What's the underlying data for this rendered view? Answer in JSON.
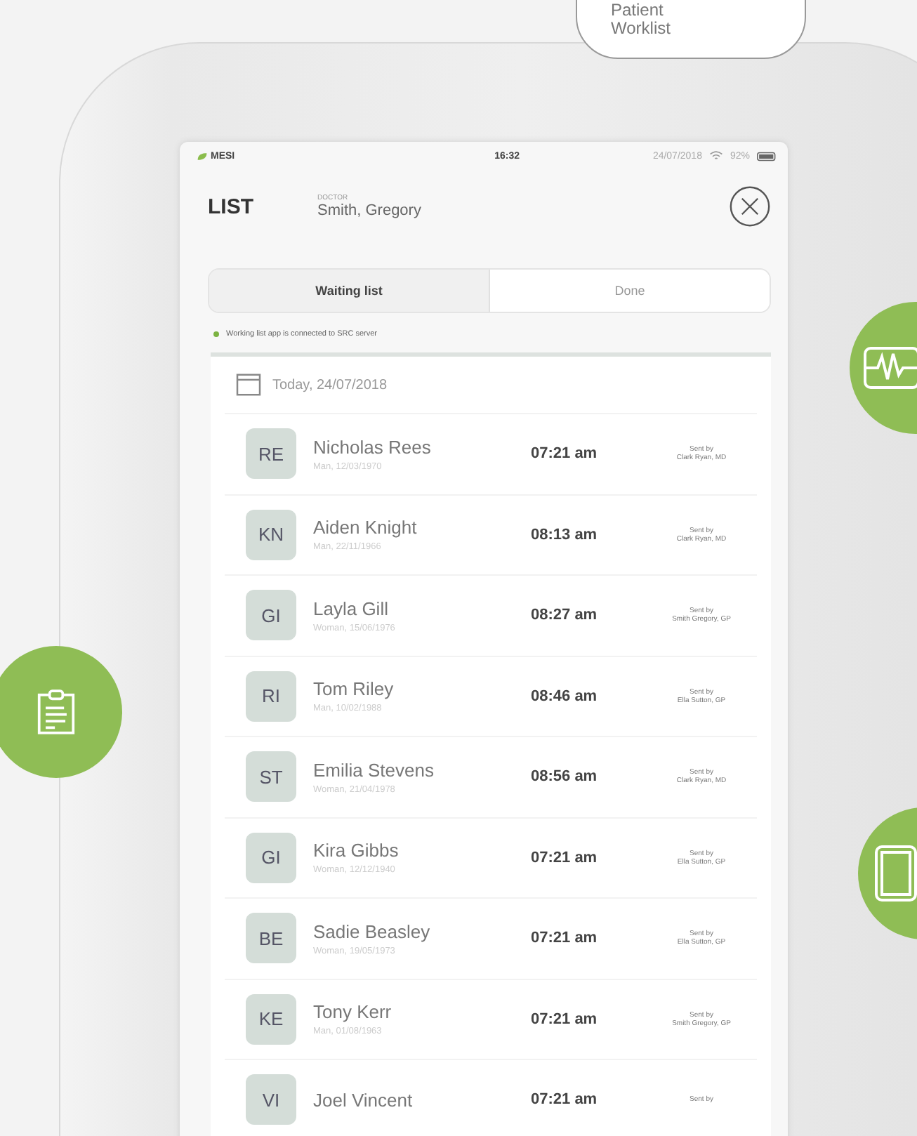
{
  "callout": {
    "lines": [
      "Patient",
      "Worklist"
    ]
  },
  "status_bar": {
    "brand": "MESI",
    "time": "16:32",
    "date": "24/07/2018",
    "battery": "92%"
  },
  "header": {
    "title": "LIST",
    "role": "DOCTOR",
    "doctor": "Smith, Gregory"
  },
  "tabs": [
    {
      "label": "Waiting list",
      "selected": true
    },
    {
      "label": "Done",
      "selected": false
    }
  ],
  "connection": {
    "text": "Working list app is connected to SRC server",
    "connected": true
  },
  "date_heading": "Today, 24/07/2018",
  "patients": [
    {
      "initials": "RE",
      "name": "Nicholas Rees",
      "info": "Man, 12/03/1970",
      "time": "07:21 am",
      "sent_label": "Sent by",
      "sender": "Clark Ryan, MD"
    },
    {
      "initials": "KN",
      "name": "Aiden Knight",
      "info": "Man, 22/11/1966",
      "time": "08:13 am",
      "sent_label": "Sent by",
      "sender": "Clark Ryan, MD"
    },
    {
      "initials": "GI",
      "name": "Layla Gill",
      "info": "Woman, 15/06/1976",
      "time": "08:27 am",
      "sent_label": "Sent by",
      "sender": "Smith Gregory, GP"
    },
    {
      "initials": "RI",
      "name": "Tom Riley",
      "info": "Man, 10/02/1988",
      "time": "08:46 am",
      "sent_label": "Sent by",
      "sender": "Ella Sutton, GP"
    },
    {
      "initials": "ST",
      "name": "Emilia Stevens",
      "info": "Woman, 21/04/1978",
      "time": "08:56 am",
      "sent_label": "Sent by",
      "sender": "Clark Ryan, MD"
    },
    {
      "initials": "GI",
      "name": "Kira Gibbs",
      "info": "Woman, 12/12/1940",
      "time": "07:21 am",
      "sent_label": "Sent by",
      "sender": "Ella Sutton, GP"
    },
    {
      "initials": "BE",
      "name": "Sadie Beasley",
      "info": "Woman, 19/05/1973",
      "time": "07:21 am",
      "sent_label": "Sent by",
      "sender": "Ella Sutton, GP"
    },
    {
      "initials": "KE",
      "name": "Tony Kerr",
      "info": "Man, 01/08/1963",
      "time": "07:21 am",
      "sent_label": "Sent by",
      "sender": "Smith Gregory, GP"
    },
    {
      "initials": "VI",
      "name": "Joel Vincent",
      "time": "07:21 am",
      "sent_label": "Sent by"
    }
  ]
}
